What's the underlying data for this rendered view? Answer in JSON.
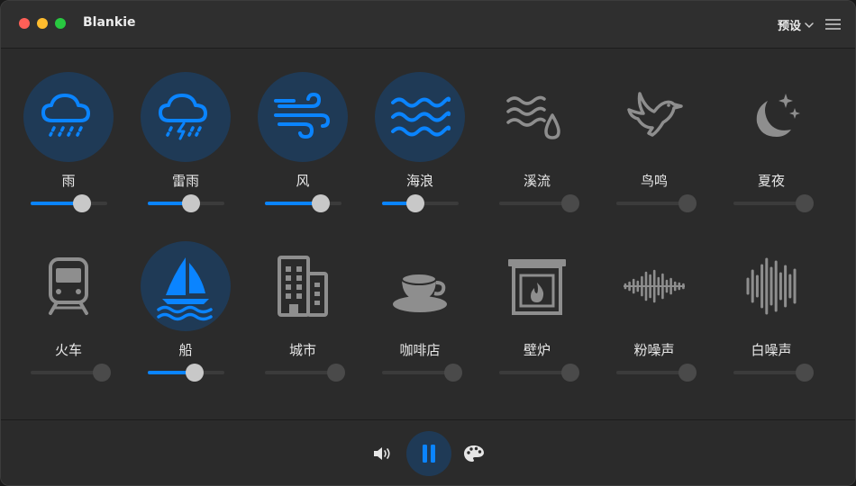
{
  "window": {
    "title": "Blankie"
  },
  "header": {
    "preset_label": "预设"
  },
  "colors": {
    "accent": "#0a84ff",
    "active_circle": "#1f3a56",
    "inactive_icon": "#8e8e8e"
  },
  "sounds": [
    {
      "label": "雨",
      "icon": "cloud-rain-icon",
      "active": true,
      "volume": 0.72
    },
    {
      "label": "雷雨",
      "icon": "cloud-bolt-rain-icon",
      "active": true,
      "volume": 0.58
    },
    {
      "label": "风",
      "icon": "wind-icon",
      "active": true,
      "volume": 0.8
    },
    {
      "label": "海浪",
      "icon": "water-waves-icon",
      "active": true,
      "volume": 0.42
    },
    {
      "label": "溪流",
      "icon": "stream-drop-icon",
      "active": false,
      "volume": 0.0
    },
    {
      "label": "鸟鸣",
      "icon": "bird-icon",
      "active": false,
      "volume": 0.0
    },
    {
      "label": "夏夜",
      "icon": "moon-stars-icon",
      "active": false,
      "volume": 0.0
    },
    {
      "label": "火车",
      "icon": "train-icon",
      "active": false,
      "volume": 0.0
    },
    {
      "label": "船",
      "icon": "sailboat-icon",
      "active": true,
      "volume": 0.65
    },
    {
      "label": "城市",
      "icon": "building-icon",
      "active": false,
      "volume": 0.0
    },
    {
      "label": "咖啡店",
      "icon": "coffee-cup-icon",
      "active": false,
      "volume": 0.0
    },
    {
      "label": "壁炉",
      "icon": "fireplace-icon",
      "active": false,
      "volume": 0.0
    },
    {
      "label": "粉噪声",
      "icon": "pink-noise-waveform-icon",
      "active": false,
      "volume": 0.0
    },
    {
      "label": "白噪声",
      "icon": "white-noise-waveform-icon",
      "active": false,
      "volume": 0.0
    }
  ],
  "footer": {
    "volume_icon": "speaker-icon",
    "play_state": "playing",
    "palette_icon": "palette-icon"
  }
}
